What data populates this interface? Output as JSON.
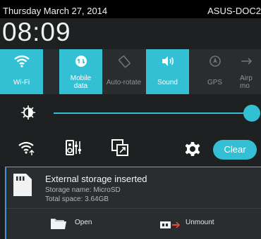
{
  "status_bar": {
    "date": "Thursday March 27, 2014",
    "device": "ASUS-DOC2"
  },
  "clock": "08:09",
  "quick_settings": [
    {
      "label": "Wi-Fi",
      "icon": "wifi-icon",
      "active": true
    },
    {
      "label": "Mobile\ndata",
      "icon": "mobile-data-icon",
      "active": true
    },
    {
      "label": "Auto-rotate",
      "icon": "auto-rotate-icon",
      "active": false
    },
    {
      "label": "Sound",
      "icon": "sound-icon",
      "active": true
    },
    {
      "label": "GPS",
      "icon": "gps-icon",
      "active": false
    },
    {
      "label": "Airp\nmo",
      "icon": "airplane-icon",
      "active": false
    }
  ],
  "brightness": {
    "level": 1.0,
    "icon": "brightness-icon"
  },
  "tools": {
    "icons": [
      "wifi-settings-icon",
      "audio-wizard-icon",
      "screen-mirror-icon",
      "settings-gear-icon"
    ],
    "clear_label": "Clear"
  },
  "notification": {
    "icon": "sd-card-icon",
    "title": "External storage inserted",
    "line1": "Storage name: MicroSD",
    "line2": "Total space: 3.64GB",
    "actions": [
      {
        "label": "Open",
        "icon": "folder-icon"
      },
      {
        "label": "Unmount",
        "icon": "unmount-icon"
      }
    ]
  },
  "colors": {
    "accent": "#33c0d4",
    "background": "#1b1d1e"
  }
}
